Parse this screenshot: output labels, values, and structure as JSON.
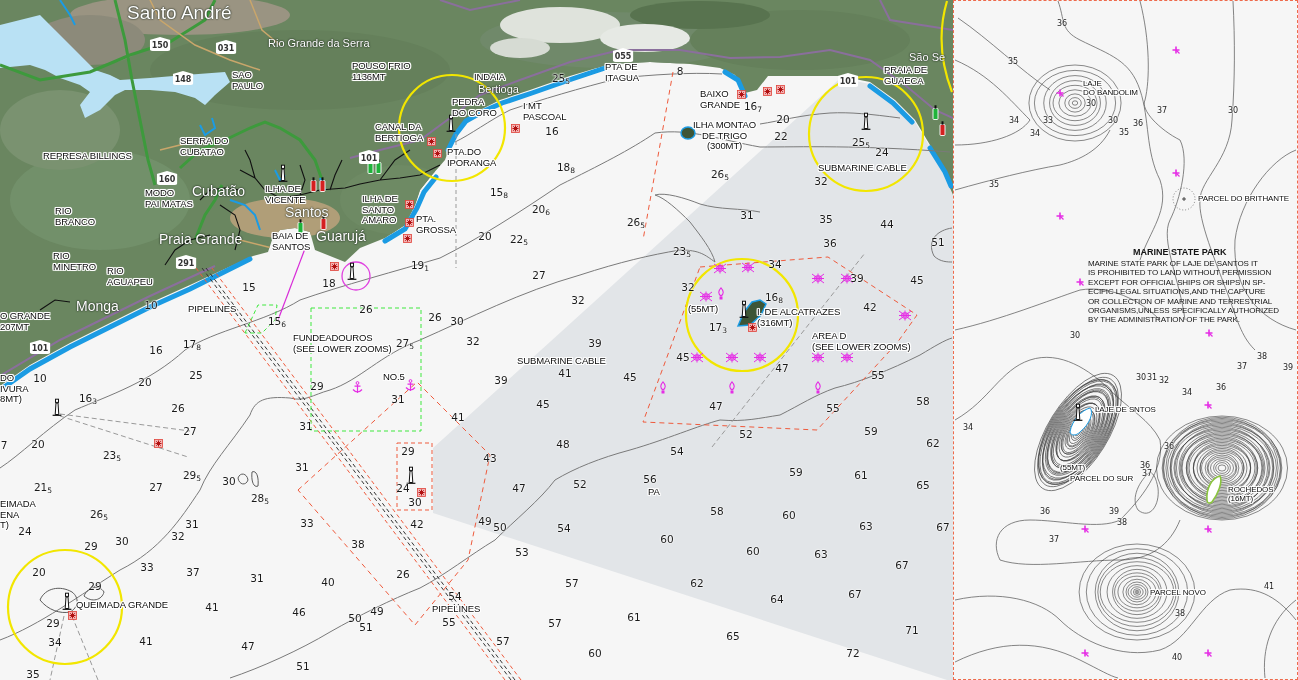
{
  "chart": {
    "place_names": [
      {
        "text": "Santo André",
        "kind": "city"
      },
      {
        "text": "Rio Grande da Serra",
        "kind": "village"
      },
      {
        "text": "São Se",
        "kind": "village"
      },
      {
        "text": "Bertioga",
        "kind": "village"
      },
      {
        "text": "Cubatão",
        "kind": "town"
      },
      {
        "text": "Santos",
        "kind": "town"
      },
      {
        "text": "Praia Grande",
        "kind": "town"
      },
      {
        "text": "Guarujá",
        "kind": "town"
      },
      {
        "text": "Monga",
        "kind": "town"
      }
    ],
    "route_shields": [
      "150",
      "031",
      "055",
      "148",
      "101",
      "101",
      "160",
      "291",
      "101"
    ],
    "labels": [
      {
        "lines": [
          "SAO",
          "PAULO"
        ]
      },
      {
        "lines": [
          "POUSO FRIO",
          "1136MT"
        ]
      },
      {
        "lines": [
          "INDAIA"
        ]
      },
      {
        "lines": [
          "PTA DE",
          "ITAGUA"
        ]
      },
      {
        "lines": [
          "PRAIA DE",
          "GUAECA"
        ]
      },
      {
        "lines": [
          "PEDRA",
          "DO CORO"
        ]
      },
      {
        "lines": [
          "I MT",
          "PASCOAL"
        ]
      },
      {
        "lines": [
          "BAIXO",
          "GRANDE"
        ]
      },
      {
        "lines": [
          "REPRESA BILLINGS"
        ]
      },
      {
        "lines": [
          "SERRA DO",
          "CUBATAO"
        ]
      },
      {
        "lines": [
          "CANAL DA",
          "BERTIOGA"
        ]
      },
      {
        "lines": [
          "PTA.DO",
          "IPORANGA"
        ]
      },
      {
        "lines": [
          "ILHA MONTAO",
          "DE TRIGO",
          "(300MT)"
        ]
      },
      {
        "lines": [
          "SUBMARINE CABLE"
        ]
      },
      {
        "lines": [
          "RIO",
          "BRANCO"
        ]
      },
      {
        "lines": [
          "MODO",
          "PAI MATAS"
        ]
      },
      {
        "lines": [
          "ILHA DE",
          "VICENTE"
        ]
      },
      {
        "lines": [
          "ILHA DE",
          "SANTO",
          "AMARO"
        ]
      },
      {
        "lines": [
          "BAIA DE",
          "SANTOS"
        ]
      },
      {
        "lines": [
          "PTA.",
          "GROSSA"
        ]
      },
      {
        "lines": [
          "RIO",
          "MINETRO"
        ]
      },
      {
        "lines": [
          "RIO",
          "AGUAPEU"
        ]
      },
      {
        "lines": [
          "O GRANDE",
          "207MT"
        ]
      },
      {
        "lines": [
          "PIPELINES"
        ]
      },
      {
        "lines": [
          "(55MT)"
        ]
      },
      {
        "lines": [
          "I. DE ALCATRAZES",
          "(316MT)"
        ]
      },
      {
        "lines": [
          "FUNDEADOUROS",
          "(SEE LOWER ZOOMS)"
        ]
      },
      {
        "lines": [
          "AREA D",
          "(SEE LOWER ZOOMS)"
        ]
      },
      {
        "lines": [
          "SUBMARINE CABLE"
        ]
      },
      {
        "lines": [
          "DO",
          "IVURA",
          "8MT)"
        ]
      },
      {
        "lines": [
          "NO.5"
        ]
      },
      {
        "lines": [
          "PA"
        ]
      },
      {
        "lines": [
          "EIMADA",
          "ENA",
          "T)"
        ]
      },
      {
        "lines": [
          "QUEIMADA GRANDE"
        ]
      },
      {
        "lines": [
          "PIPELINES"
        ]
      }
    ],
    "soundings": [
      "25$_{5}$",
      "8",
      "16$_{7}$",
      "20",
      "16",
      "22",
      "25$_{5}$",
      "24",
      "18$_{8}$",
      "26$_{5}$",
      "32",
      "15$_{8}$",
      "20$_{6}$",
      "26$_{5}$",
      "31",
      "35",
      "44",
      "20",
      "22$_{5}$",
      "23$_{5}$",
      "36",
      "51",
      "19$_{1}$",
      "34",
      "15",
      "18",
      "27",
      "32",
      "39",
      "45",
      "10",
      "26",
      "32",
      "16$_{8}$",
      "42",
      "15$_{6}$",
      "26",
      "30",
      "17$_{3}$",
      "16",
      "17$_{8}$",
      "27$_{5}$",
      "32",
      "39",
      "45",
      "10",
      "20",
      "25",
      "39",
      "41",
      "45",
      "47",
      "55",
      "29",
      "16$_{3}$",
      "26",
      "31",
      "45",
      "47",
      "55",
      "58",
      "27",
      "31",
      "41",
      "52",
      "59",
      "7",
      "20",
      "48",
      "62",
      "23$_{5}$",
      "29",
      "43",
      "54",
      "29$_{5}$",
      "31",
      "56",
      "59",
      "61",
      "21$_{5}$",
      "27",
      "30",
      "24",
      "47",
      "52",
      "65",
      "28$_{5}$",
      "30",
      "26$_{5}$",
      "58",
      "60",
      "24",
      "31",
      "33",
      "42",
      "49",
      "50",
      "54",
      "63",
      "67",
      "29",
      "30",
      "32",
      "38",
      "60",
      "53",
      "60",
      "63",
      "20",
      "33",
      "37",
      "26",
      "67",
      "29",
      "31",
      "40",
      "57",
      "62",
      "54",
      "64",
      "67",
      "41",
      "46",
      "49",
      "29",
      "50",
      "51",
      "55",
      "57",
      "61",
      "65",
      "71",
      "34",
      "41",
      "47",
      "57",
      "60",
      "72",
      "35",
      "51"
    ]
  },
  "inset": {
    "title": "MARINE STATE PARK",
    "notice": [
      "MARINE STATE PARK OF LAJE DE SANTOS IT",
      "IS PROHIBITED TO LAND WITHOUT PERMISSION",
      "EXCEPT FOR OFFICIAL SHIPS OR SHIPS IN SP-",
      "ECIFIC LEGAL SITUATIONS,AND THE CAPTURE",
      "OR COLLECTION OF MARINE AND TERRESTRIAL",
      "ORGANISMS,UNLESS SPECIFICALLY AUTHORIZED",
      "BY THE ADMINISTRATION OF THE PARK."
    ],
    "labels": [
      {
        "lines": [
          "LAJE",
          "DO BANDOLIM"
        ]
      },
      {
        "lines": [
          "PARCEL DO BRITHANTE"
        ]
      },
      {
        "lines": [
          "LAJE DE SNTOS"
        ]
      },
      {
        "lines": [
          "(55MT)"
        ]
      },
      {
        "lines": [
          "PARCEL DO SUR"
        ]
      },
      {
        "lines": [
          "ROCHEDOS",
          "(16MT)"
        ]
      },
      {
        "lines": [
          "PARCEL NOVO"
        ]
      }
    ],
    "soundings": [
      "36",
      "35",
      "30",
      "37",
      "30",
      "34",
      "33",
      "30",
      "36",
      "34",
      "35",
      "35",
      "30",
      "38",
      "37",
      "39",
      "30",
      "31",
      "32",
      "34",
      "36",
      "34",
      "36",
      "36",
      "37",
      "36",
      "39",
      "38",
      "37",
      "41",
      "38",
      "40"
    ]
  }
}
